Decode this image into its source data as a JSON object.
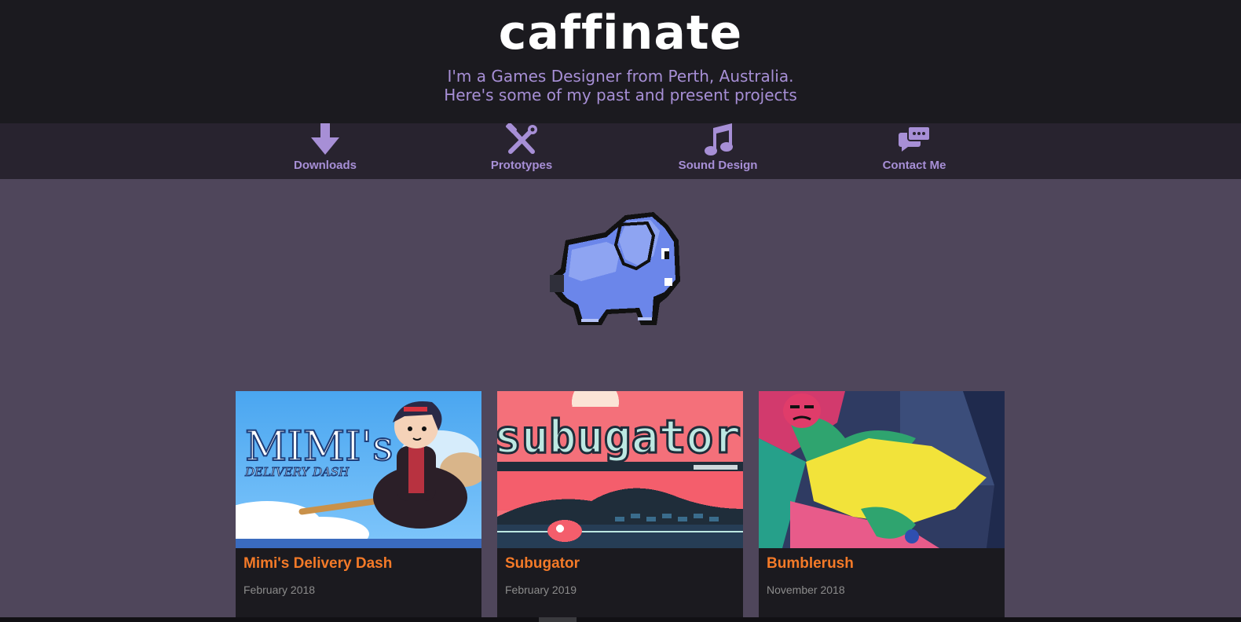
{
  "header": {
    "site_title": "caffinate",
    "tagline_line1": "I'm a Games Designer from Perth, Australia.",
    "tagline_line2": "Here's some of my past and present projects"
  },
  "nav": {
    "items": [
      {
        "label": "Downloads",
        "icon": "download-arrow-icon"
      },
      {
        "label": "Prototypes",
        "icon": "tools-icon"
      },
      {
        "label": "Sound Design",
        "icon": "music-note-icon"
      },
      {
        "label": "Contact Me",
        "icon": "chat-bubbles-icon"
      }
    ]
  },
  "mascot": {
    "icon": "pixel-elephant-logo"
  },
  "projects": [
    {
      "title": "Mimi's Delivery Dash",
      "date": "February 2018",
      "art_text_line1": "MIMI's",
      "art_text_line2": "DELIVERY DASH"
    },
    {
      "title": "Subugator",
      "date": "February 2019",
      "art_text": "subugator"
    },
    {
      "title": "Bumblerush",
      "date": "November 2018"
    }
  ],
  "colors": {
    "header_bg": "#1b1a1f",
    "nav_bg": "#28232f",
    "page_bg": "#4f465b",
    "accent_purple": "#a78fd6",
    "title_orange": "#f47a28",
    "card_bg": "#1b1a1f"
  }
}
